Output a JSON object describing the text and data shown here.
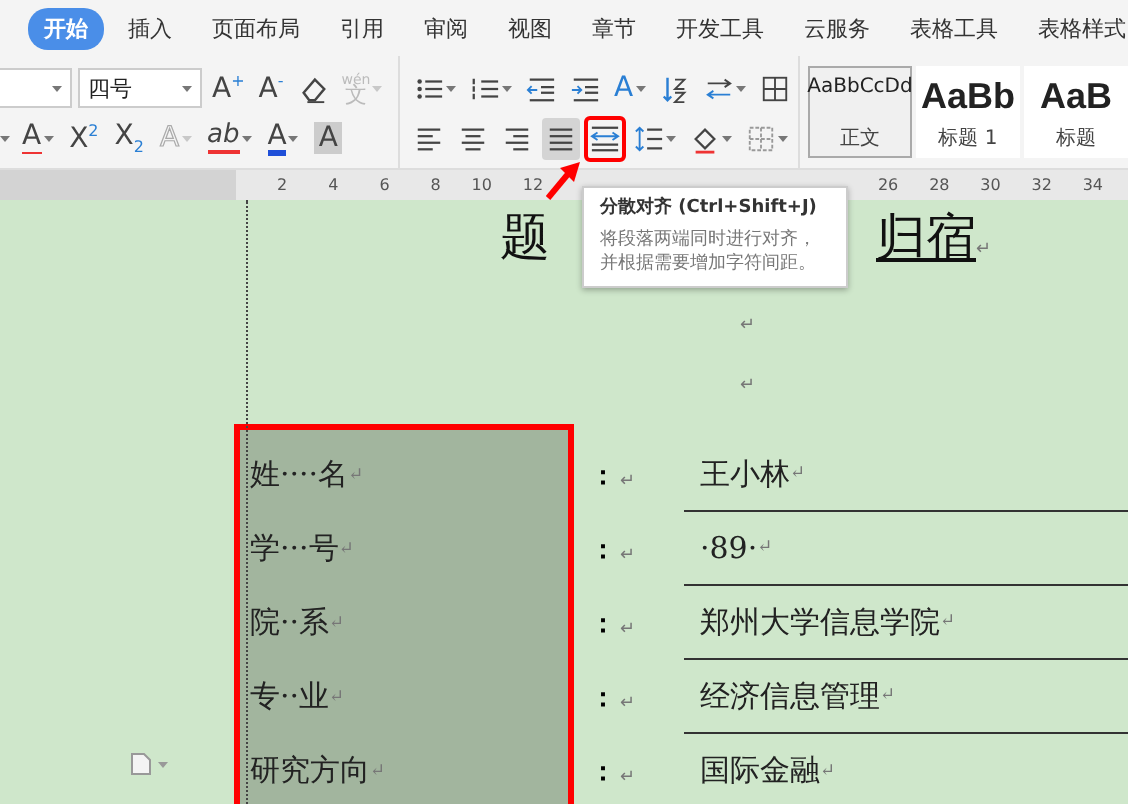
{
  "menu_tabs": [
    {
      "label": "开始",
      "selected": true
    },
    {
      "label": "插入",
      "selected": false
    },
    {
      "label": "页面布局",
      "selected": false
    },
    {
      "label": "引用",
      "selected": false
    },
    {
      "label": "审阅",
      "selected": false
    },
    {
      "label": "视图",
      "selected": false
    },
    {
      "label": "章节",
      "selected": false
    },
    {
      "label": "开发工具",
      "selected": false
    },
    {
      "label": "云服务",
      "selected": false
    },
    {
      "label": "表格工具",
      "selected": false
    },
    {
      "label": "表格样式",
      "selected": false
    }
  ],
  "font_size_field": {
    "value": "四号"
  },
  "font_tools_row1": [
    {
      "kind": "grow",
      "text": "A$^{+}$",
      "caret": false,
      "disabled": false,
      "selected": false
    },
    {
      "kind": "shrink",
      "text": "A$^{-}$",
      "caret": false,
      "disabled": false,
      "selected": false
    },
    {
      "kind": "eraser",
      "caret": false,
      "disabled": false,
      "selected": false
    },
    {
      "kind": "ruby",
      "ruby": "wén",
      "text": "文",
      "caret": true,
      "disabled": true,
      "selected": false
    }
  ],
  "font_tools_row2": [
    {
      "kind": "strike",
      "text": "A",
      "caret": true,
      "disabled": false,
      "selected": false
    },
    {
      "kind": "superscript",
      "text": "X$^{2}$",
      "caret": false,
      "disabled": false,
      "selected": false
    },
    {
      "kind": "subscript",
      "text": "X$_{2}$",
      "caret": false,
      "disabled": false,
      "selected": false
    },
    {
      "kind": "outline",
      "text": "A",
      "caret": true,
      "disabled": true,
      "selected": false
    },
    {
      "kind": "highlight",
      "text": "ab",
      "caret": true,
      "disabled": false,
      "selected": false
    },
    {
      "kind": "color",
      "text": "A",
      "caret": true,
      "disabled": false,
      "selected": false
    },
    {
      "kind": "shaded",
      "text": "A",
      "caret": false,
      "disabled": false,
      "selected": false
    }
  ],
  "para_tools_row1": [
    {
      "kind": "bullets",
      "caret": true,
      "disabled": false,
      "selected": false
    },
    {
      "kind": "numbering",
      "caret": true,
      "disabled": false,
      "selected": false
    },
    {
      "kind": "outdent",
      "caret": false,
      "disabled": false,
      "selected": false
    },
    {
      "kind": "indent",
      "caret": false,
      "disabled": false,
      "selected": false
    },
    {
      "kind": "scale",
      "text": "A",
      "caret": true,
      "disabled": false,
      "selected": false
    },
    {
      "kind": "sort",
      "caret": false,
      "disabled": false,
      "selected": false
    },
    {
      "kind": "breaks",
      "caret": true,
      "disabled": false,
      "selected": false
    },
    {
      "kind": "table",
      "caret": false,
      "disabled": false,
      "selected": false
    }
  ],
  "para_tools_row2": [
    {
      "kind": "align_left",
      "caret": false,
      "disabled": false,
      "selected": false,
      "marked": false
    },
    {
      "kind": "align_center",
      "caret": false,
      "disabled": false,
      "selected": false,
      "marked": false
    },
    {
      "kind": "align_right",
      "caret": false,
      "disabled": false,
      "selected": false,
      "marked": false
    },
    {
      "kind": "justify",
      "caret": false,
      "disabled": false,
      "selected": true,
      "marked": false
    },
    {
      "kind": "distribute",
      "caret": false,
      "disabled": false,
      "selected": false,
      "marked": true
    },
    {
      "kind": "spacing",
      "caret": true,
      "disabled": false,
      "selected": false,
      "marked": false
    },
    {
      "kind": "shading",
      "caret": true,
      "disabled": false,
      "selected": false,
      "marked": false
    },
    {
      "kind": "borders",
      "caret": true,
      "disabled": false,
      "selected": false,
      "marked": false
    }
  ],
  "styles": [
    {
      "kind": "body",
      "preview": "AaBbCcDd",
      "name": "正文",
      "selected": true
    },
    {
      "kind": "heading",
      "preview": "AaBb",
      "name": "标题 1",
      "selected": false
    },
    {
      "kind": "heading",
      "preview": "AaB",
      "name": "标题",
      "selected": false
    }
  ],
  "ruler": {
    "left_numbers": [
      "2",
      "4",
      "6",
      "8",
      "10",
      "12"
    ],
    "right_numbers": [
      "26",
      "28",
      "30",
      "32",
      "34"
    ]
  },
  "tooltip": {
    "title": "分散对齐 (Ctrl+Shift+J)",
    "body": "将段落两端同时进行对齐，并根据需要增加字符间距。"
  },
  "title": {
    "left": "题",
    "right": "归宿",
    "mark": "↵"
  },
  "empty_paragraphs": [
    {
      "mark": "↵"
    },
    {
      "mark": "↵"
    }
  ],
  "form_rows": [
    {
      "label": "姓····名",
      "label_mark": "↵",
      "colon": "：",
      "colon_mark": "↵",
      "value": "王小林",
      "value_mark": "↵"
    },
    {
      "label": "学···号",
      "label_mark": "↵",
      "colon": "：",
      "colon_mark": "↵",
      "value": "·89·",
      "value_mark": "↵"
    },
    {
      "label": "院··系",
      "label_mark": "↵",
      "colon": "：",
      "colon_mark": "↵",
      "value": "郑州大学信息学院",
      "value_mark": "↵"
    },
    {
      "label": "专··业",
      "label_mark": "↵",
      "colon": "：",
      "colon_mark": "↵",
      "value": "经济信息管理",
      "value_mark": "↵"
    },
    {
      "label": "研究方向",
      "label_mark": "↵",
      "colon": "：",
      "colon_mark": "↵",
      "value": "国际金融",
      "value_mark": "↵"
    }
  ]
}
